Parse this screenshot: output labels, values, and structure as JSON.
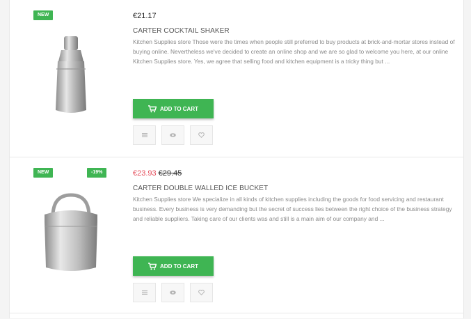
{
  "products": [
    {
      "flag_new": "NEW",
      "price": "€21.17",
      "title": "CARTER COCKTAIL SHAKER",
      "description": "Kitchen Supplies store Those were the times when people still preferred to buy products at brick-and-mortar stores instead of buying online. Nevertheless we've decided to create an online shop and we are so glad to welcome you here, at our online Kitchen Supplies store. Yes, we agree that selling food and kitchen equipment is a tricky thing but ...",
      "add_to_cart": "ADD TO CART",
      "image": "cocktail-shaker"
    },
    {
      "flag_new": "NEW",
      "flag_discount": "-19%",
      "price": "€23.93",
      "old_price": "€29.45",
      "title": "CARTER DOUBLE WALLED ICE BUCKET",
      "description": "Kitchen Supplies store We specialize in all kinds of kitchen supplies including the goods for food servicing and restaurant business. Every business is very demanding but the secret of success lies between the right choice of the business strategy and reliable suppliers. Taking care of our clients was and still is a main aim of our company and ...",
      "add_to_cart": "ADD TO CART",
      "image": "ice-bucket"
    }
  ],
  "icons": {
    "cart": "cart-icon",
    "compare": "compare-icon",
    "quick_view": "eye-icon",
    "wishlist": "heart-icon"
  },
  "colors": {
    "accent": "#3fb553",
    "sale_price": "#e54c5a"
  }
}
